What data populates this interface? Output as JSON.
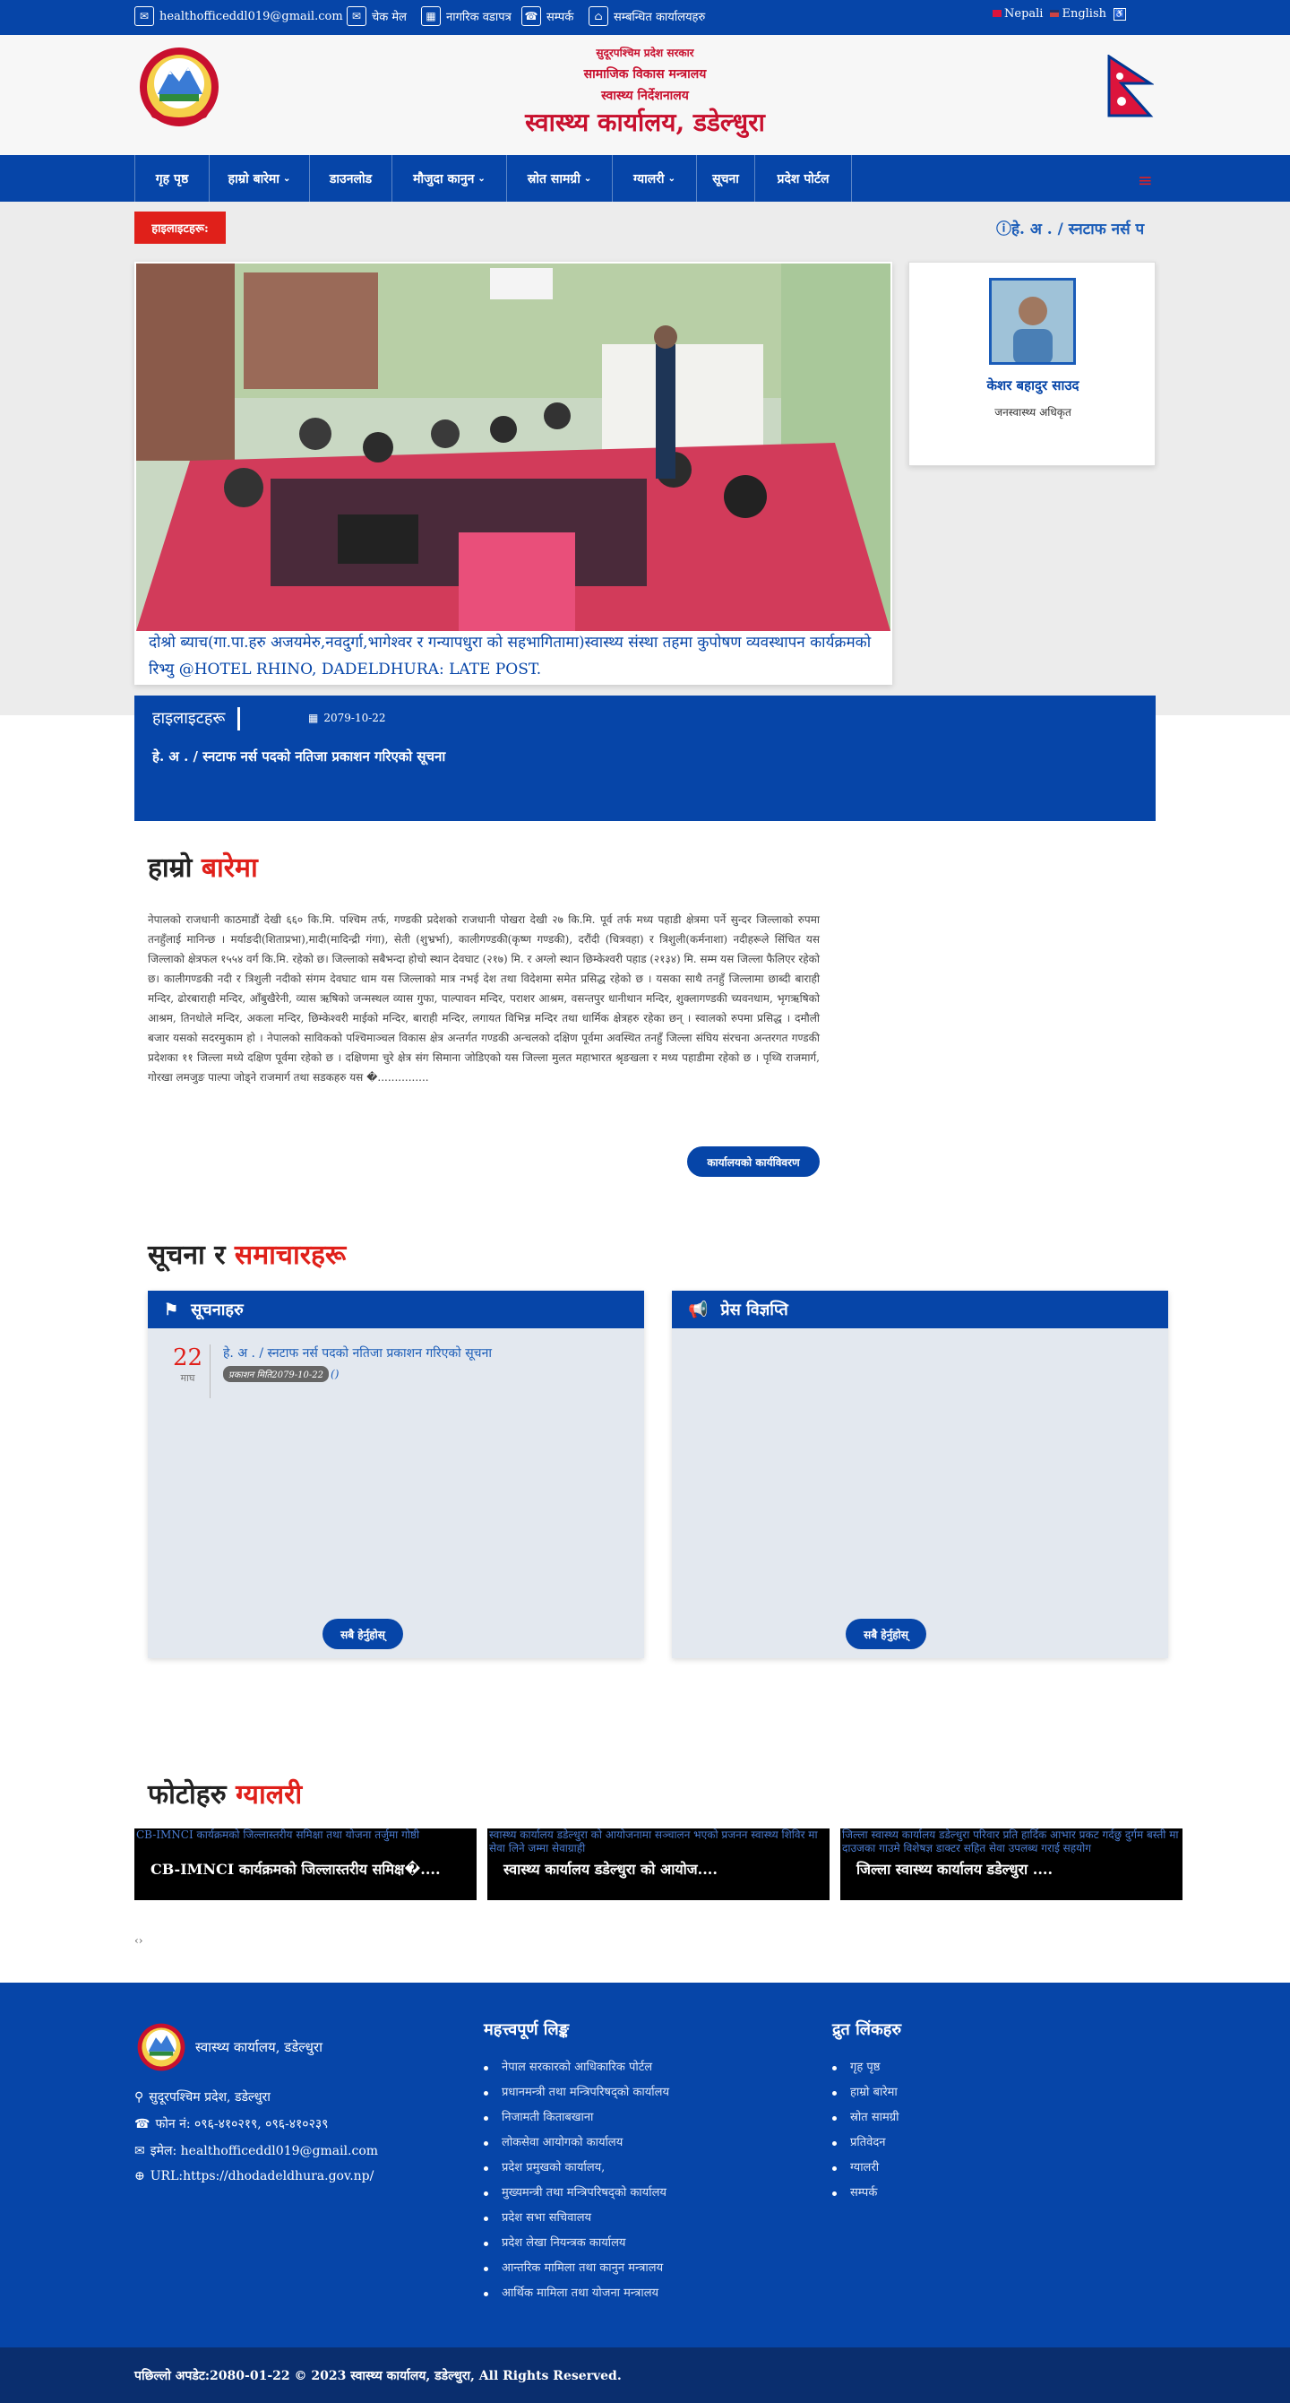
{
  "topbar": {
    "email": "healthofficeddl019@gmail.com",
    "links": [
      "चेक मेल",
      "नागरिक वडापत्र",
      "सम्पर्क",
      "सम्बन्धित कार्यालयहरु"
    ],
    "lang_nepali": "Nepali",
    "lang_english": "English"
  },
  "header": {
    "line1": "सुदूरपश्चिम प्रदेश सरकार",
    "line2": "सामाजिक विकास मन्त्रालय",
    "line3": "स्वास्थ्य निर्देशनालय",
    "title": "स्वास्थ्य कार्यालय, डडेल्धुरा"
  },
  "nav": {
    "items": [
      {
        "label": "गृह पृष्ठ"
      },
      {
        "label": "हाम्रो बारेमा"
      },
      {
        "label": "डाउनलोड"
      },
      {
        "label": "मौजुदा कानुन"
      },
      {
        "label": "स्रोत सामग्री"
      },
      {
        "label": "ग्यालरी"
      },
      {
        "label": "सूचना"
      },
      {
        "label": "प्रदेश पोर्टल"
      }
    ]
  },
  "highlights": {
    "tag": "हाइलाइटहरू:",
    "ticker": "हे. अ . / स्नटाफ नर्स प",
    "box_label": "हाइलाइटहरू",
    "box_date": "2079-10-22",
    "box_text": "हे. अ . / स्नटाफ नर्स पदको नतिजा प्रकाशन गरिएको सूचना"
  },
  "slider": {
    "caption": "दोश्रो ब्याच(गा.पा.हरु अजयमेरु,नवदुर्गा,भागेश्वर र गन्यापधुरा को सहभागितामा)स्वास्थ्य संस्था तहमा कुपोषण व्यवस्थापन कार्यक्रमको रिभ्यु @HOTEL RHINO, DADELDHURA: LATE POST."
  },
  "profile": {
    "name": "केशर बहादुर साउद",
    "role": "जनस्वास्थ्य अधिकृत"
  },
  "about": {
    "title_a": "हाम्रो",
    "title_b": "बारेमा",
    "text": "नेपालको राजधानी काठमाडौं देखी ६६० कि.मि. पश्चिम तर्फ, गण्डकी प्रदेशको राजधानी पोखरा देखी २७ कि.मि. पूर्व तर्फ मध्य पहाडी क्षेत्रमा पर्ने सुन्दर जिल्लाको रुपमा तनहुँलाई मानिन्छ । मर्याङदी(शिताप्रभा),मादी(मादिन्द्री गंगा), सेती (शुभ्रर्भा), कालीगण्डकी(कृष्ण गण्डकी), दरौंदी (चित्रवहा) र त्रिशुली(कर्मनाशा) नदीहरूले सिंचित यस जिल्लाको क्षेत्रफल १५५४ वर्ग कि.मि. रहेको छ। जिल्लाको सबैभन्दा होचो स्थान देवघाट (२१७) मि. र अग्लो स्थान छिम्केश्वरी पहाड (२१३४) मि. सम्म यस जिल्ला फैलिएर रहेको छ। कालीगण्डकी नदी र त्रिशुली नदीको संगम देवघाट धाम यस जिल्लाको मात्र नभई देश तथा विदेशमा समेत प्रसिद्ध रहेको छ । यसका साथै तनहुँ जिल्लामा छाब्दी बाराही मन्दिर, ढोरबाराही मन्दिर, आँबुखैरेनी, व्यास ऋषिको जन्मस्थल व्यास गुफा, पाल्पावन मन्दिर, पराशर आश्रम, वसन्तपुर धानीथान मन्दिर, शुक्लागण्डकी च्यवनधाम, भृगऋषिको आश्रम, तिनधोले मन्दिर, अकला मन्दिर, छिम्केश्वरी माईको मन्दिर, बाराही मन्दिर, लगायत विभिन्न मन्दिर तथा धार्मिक क्षेत्रहरु रहेका छन् ।  स्वालको रुपमा प्रसिद्ध । दमौली बजार यसको सदरमुकाम हो । नेपालको साविकको पश्चिमाञ्चल विकास क्षेत्र अन्तर्गत गण्डकी अन्चलको दक्षिण पूर्वमा अवस्थित तनहुँ जिल्ला संघिय संरचना अन्तरगत गण्डकी प्रदेशका ११ जिल्ला मध्ये दक्षिण पूर्वमा रहेको छ । दक्षिणमा चुरे क्षेत्र संग सिमाना जोडिएको यस जिल्ला मुलत महाभारत श्रृङखला र मध्य पहाडीमा रहेको छ । पृथ्वि राजमार्ग, गोरखा लमजुङ पाल्पा जोड्ने राजमार्ग तथा सडकहरु यस �...............",
    "button": "कार्यालयको कार्यविवरण"
  },
  "news": {
    "title_a": "सूचना र",
    "title_b": "समाचारहरू",
    "notices_title": "सूचनाहरु",
    "press_title": "प्रेस विज्ञप्ति",
    "notice": {
      "day": "22",
      "month": "माघ",
      "title": "हे. अ . / स्नटाफ नर्स पदको नतिजा प्रकाशन गरिएको सूचना",
      "badge": "प्रकाशन मिति2079-10-22",
      "extra": "()"
    },
    "view_all": "सबै हेर्नुहोस्"
  },
  "gallery": {
    "title_a": "फोटोहरु",
    "title_b": "ग्यालरी",
    "items": [
      {
        "alt": "CB-IMNCI कार्यक्रमको जिल्लास्तरीय समिक्षा तथा योजना तर्जुमा गोष्ठी",
        "caption": "CB-IMNCI कार्यक्रमको जिल्लास्तरीय समिक्ष�...."
      },
      {
        "alt": "स्वास्थ्य कार्यालय डडेल्धुरा को आयोजनामा सञ्चालन भएको प्रजनन स्वास्थ्य शिविर मा सेवा लिने जम्मा सेवाग्राही",
        "caption": "स्वास्थ्य कार्यालय डडेल्धुरा को आयोज...."
      },
      {
        "alt": "जिल्ला स्वास्थ्य कार्यालय डडेल्धुरा परिवार प्रति हार्दिक आभार प्रकट गर्दछु दुर्गम बस्ती मा दाउजका गाउमे विशेषज्ञ डाक्टर सहित सेवा उपलब्ध गराई सहयोग",
        "caption": "जिल्ला स्वास्थ्य कार्यालय डडेल्धुरा ...."
      }
    ],
    "pager": "‹›"
  },
  "footer": {
    "org": "स्वास्थ्य कार्यालय, डडेल्धुरा",
    "address": "सुदूरपश्चिम प्रदेश, डडेल्धुरा",
    "phone": "फोन नं: ०९६-४१०२१९, ०९६-४१०२३९",
    "email": "इमेल: healthofficeddl019@gmail.com",
    "url": "URL:https://dhodadeldhura.gov.np/",
    "links_title": "महत्त्वपूर्ण लिङ्क",
    "links": [
      "नेपाल सरकारको आधिकारिक पोर्टल",
      "प्रधानमन्त्री तथा मन्त्रिपरिषद्को कार्यालय",
      "निजामती किताबखाना",
      "लोकसेवा आयोगको कार्यालय",
      "प्रदेश प्रमुखको कार्यालय,",
      "मुख्यमन्त्री तथा मन्त्रिपरिषद्को कार्यालय",
      "प्रदेश सभा सचिवालय",
      "प्रदेश लेखा नियन्त्रक कार्यालय",
      "आन्तरिक मामिला तथा कानुन मन्त्रालय",
      "आर्थिक मामिला तथा योजना मन्त्रालय"
    ],
    "quick_title": "द्रुत लिंकहरु",
    "quick": [
      "गृह पृष्ठ",
      "हाम्रो बारेमा",
      "स्रोत सामग्री",
      "प्रतिवेदन",
      "ग्यालरी",
      "सम्पर्क"
    ],
    "bottom": "पछिल्लो अपडेट:2080-01-22 © 2023 स्वास्थ्य कार्यालय, डडेल्धुरा, All Rights Reserved."
  },
  "colors": {
    "primary": "#0645a8",
    "accent": "#e0201a",
    "dark": "#0a2e6e"
  }
}
